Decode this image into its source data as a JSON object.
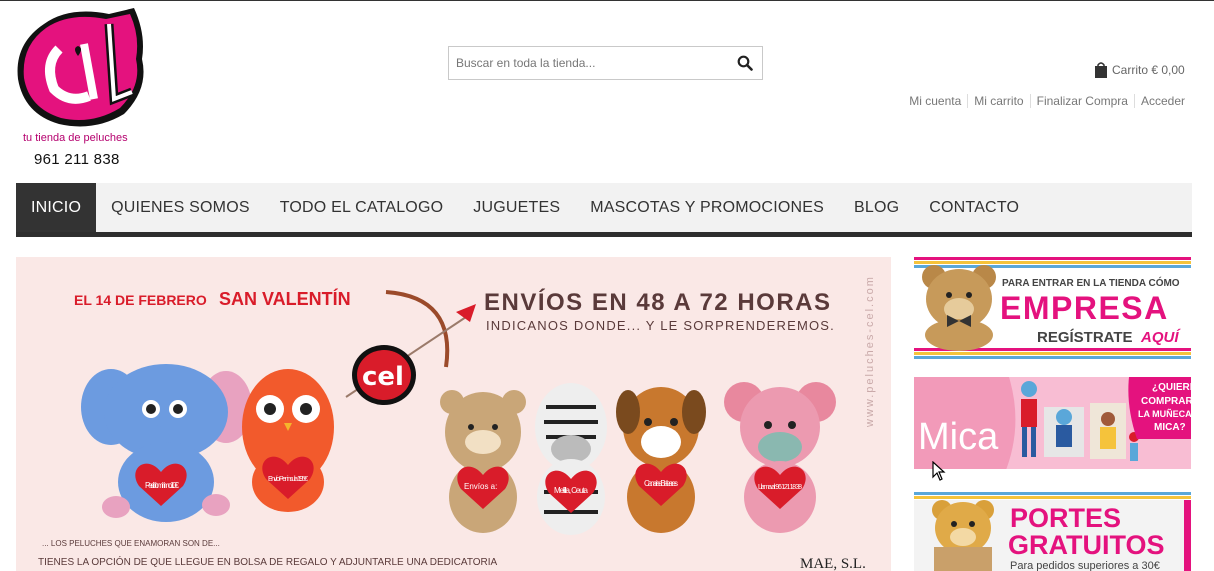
{
  "brand": {
    "logo_text": "cel",
    "tagline": "tu tienda de peluches",
    "phone": "961 211 838",
    "logo_pink": "#e4127e"
  },
  "search": {
    "placeholder": "Buscar en toda la tienda...",
    "button_icon": "search-icon"
  },
  "cart": {
    "icon": "shopping-bag-icon",
    "label": "Carrito € 0,00"
  },
  "account_links": [
    "Mi cuenta",
    "Mi carrito",
    "Finalizar Compra",
    "Acceder"
  ],
  "nav": {
    "items": [
      "INICIO",
      "QUIENES SOMOS",
      "TODO EL CATALOGO",
      "JUGUETES",
      "MASCOTAS Y PROMOCIONES",
      "BLOG",
      "CONTACTO"
    ],
    "active_index": 0
  },
  "hero": {
    "date_text": "EL 14 DE FEBRERO",
    "event_text": "SAN VALENTÍN",
    "headline": "ENVÍOS EN 48 A 72 HORAS",
    "subheadline": "INDICANOS DONDE... Y LE SORPRENDEREMOS.",
    "vertical_url": "www.peluches-cel.com",
    "logo_text": "cel",
    "hearts": [
      "Pedido mínimo 10€",
      "Envío Peninsula 1'95€",
      "Envíos a:",
      "Melilla, Ceuta",
      "Canarias Baleares",
      "Llama al: 96 121 18 38"
    ],
    "footer_line1": "... LOS PELUCHES QUE ENAMORAN SON DE...",
    "footer_line2": "TIENES LA OPCIÓN DE QUE LLEGUE EN BOLSA DE REGALO Y ADJUNTARLE UNA DEDICATORIA",
    "company": "MAE, S.L.",
    "accent_red": "#d91c2a"
  },
  "side_banners": {
    "empresa": {
      "line1": "PARA ENTRAR EN LA TIENDA CÓMO",
      "line2": "EMPRESA",
      "line3a": "REGÍSTRATE",
      "line3b": "AQUÍ"
    },
    "mica": {
      "title": "Mica",
      "question": [
        "¿QUIERES",
        "COMPRAR",
        "LA MUÑECA",
        "MICA?"
      ]
    },
    "portes": {
      "line1": "PORTES",
      "line2": "GRATUITOS",
      "line3": "Para pedidos superiores a 30€"
    }
  }
}
